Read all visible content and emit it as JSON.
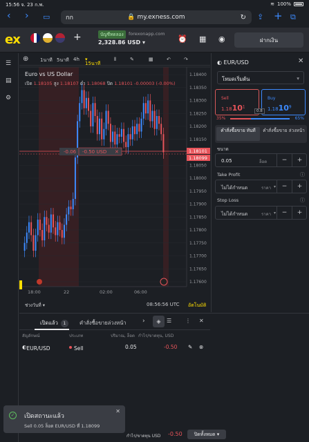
{
  "status": {
    "time": "15:56",
    "date": "จ. 23 ก.พ.",
    "battery": "100%"
  },
  "browser": {
    "aa": "กก",
    "host": "my.exness.com"
  },
  "header": {
    "logo": "ex",
    "account_type": "บัญชีทดลอง",
    "server": "forexonapp.com",
    "balance": "2,328.86 USD",
    "deposit": "ฝากเงิน"
  },
  "toolbar": {
    "t1": "1นาที",
    "t2": "5นาที",
    "t3": "4h",
    "t4": "15นาที"
  },
  "chart": {
    "title": "Euro vs US Dollar",
    "open_label": "เปิด",
    "open": "1.18105",
    "high_label": "สูง",
    "high": "1.18107",
    "low_label": "ต่ำ",
    "low": "1.18068",
    "close_label": "ปิด",
    "close": "1.18101",
    "change": "-0.00003 (-0.00%)",
    "pnl_lot": "-0.06",
    "pnl_usd": "-0.50 USD",
    "bid_price": "1.18101",
    "ask_price": "1.18099",
    "lot_range": "ช่วงวันที่",
    "clock": "08:56:56 UTC",
    "auto": "อัตโนมัติ"
  },
  "chart_data": {
    "type": "candlestick",
    "x_ticks": [
      "18:00",
      "22",
      "02:00",
      "06:00"
    ],
    "y_ticks": [
      "1.18400",
      "1.18350",
      "1.18300",
      "1.18250",
      "1.18200",
      "1.18150",
      "1.18100",
      "1.18050",
      "1.18000",
      "1.17950",
      "1.17900",
      "1.17850",
      "1.17800",
      "1.17750",
      "1.17700",
      "1.17650",
      "1.17600"
    ],
    "ylim": [
      1.176,
      1.184
    ],
    "closes": [
      1.1775,
      1.1779,
      1.1783,
      1.1778,
      1.1772,
      1.1778,
      1.1784,
      1.178,
      1.1776,
      1.1785,
      1.1782,
      1.1779,
      1.1786,
      1.1781,
      1.1778,
      1.1783,
      1.178,
      1.1777,
      1.1782,
      1.1786,
      1.1789,
      1.1788,
      1.1792,
      1.1808,
      1.1822,
      1.1829,
      1.1834,
      1.1827,
      1.1831,
      1.1826,
      1.182,
      1.1829,
      1.1824,
      1.1817,
      1.1823,
      1.1815,
      1.1819,
      1.1826,
      1.1821,
      1.1814,
      1.1818,
      1.1813,
      1.1817,
      1.1816,
      1.1819,
      1.1814,
      1.1812,
      1.1817,
      1.1815,
      1.182,
      1.1817,
      1.1821,
      1.1818,
      1.1823,
      1.1829,
      1.1825,
      1.183,
      1.1822,
      1.1826,
      1.1819,
      1.1824,
      1.1821,
      1.1817,
      1.181
    ]
  },
  "order": {
    "symbol": "EUR/USD",
    "mode": "โหมดเริ่มต้น",
    "sell_label": "Sell",
    "sell_price_a": "1.18",
    "sell_price_b": "10",
    "sell_price_c": "1",
    "buy_label": "Buy",
    "buy_price_a": "1.18",
    "buy_price_b": "10",
    "buy_price_c": "9",
    "spread": "0.8",
    "sell_pct": "35%",
    "sell_ratio": 0.35,
    "buy_pct": "65%",
    "market_order": "คำสั่งซื้อขาย ทันที",
    "pending_order": "คำสั่งซื้อขาย ล่วงหน้า",
    "volume_label": "ขนาด",
    "volume": "0.05",
    "volume_unit": "ล็อต",
    "tp_label": "Take Profit",
    "tp_value": "ไม่ได้กำหนด",
    "tp_unit": "ราคา",
    "sl_label": "Stop Loss",
    "sl_value": "ไม่ได้กำหนด",
    "sl_unit": "ราคา"
  },
  "positions": {
    "tab_open": "เปิดแล้ว",
    "tab_open_count": "1",
    "tab_pending": "คำสั่งซื้อขายล่วงหน้า",
    "h_symbol": "สัญลักษณ์",
    "h_type": "ประเภท",
    "h_volume": "ปริมาณ, ล็อต",
    "h_pl": "กำไร/ขาดทุน, USD",
    "row": {
      "symbol": "EUR/USD",
      "type": "Sell",
      "volume": "0.05",
      "pl": "-0.50"
    }
  },
  "toast": {
    "title": "เปิดสถานะแล้ว",
    "body": "Sell 0.05 ล็อต EUR/USD ที่ 1.18099"
  },
  "footer": {
    "pl_label": "กำไร/ขาดทุน USD",
    "pl_value": "-0.50",
    "close_all": "ปิดทั้งหมด"
  }
}
